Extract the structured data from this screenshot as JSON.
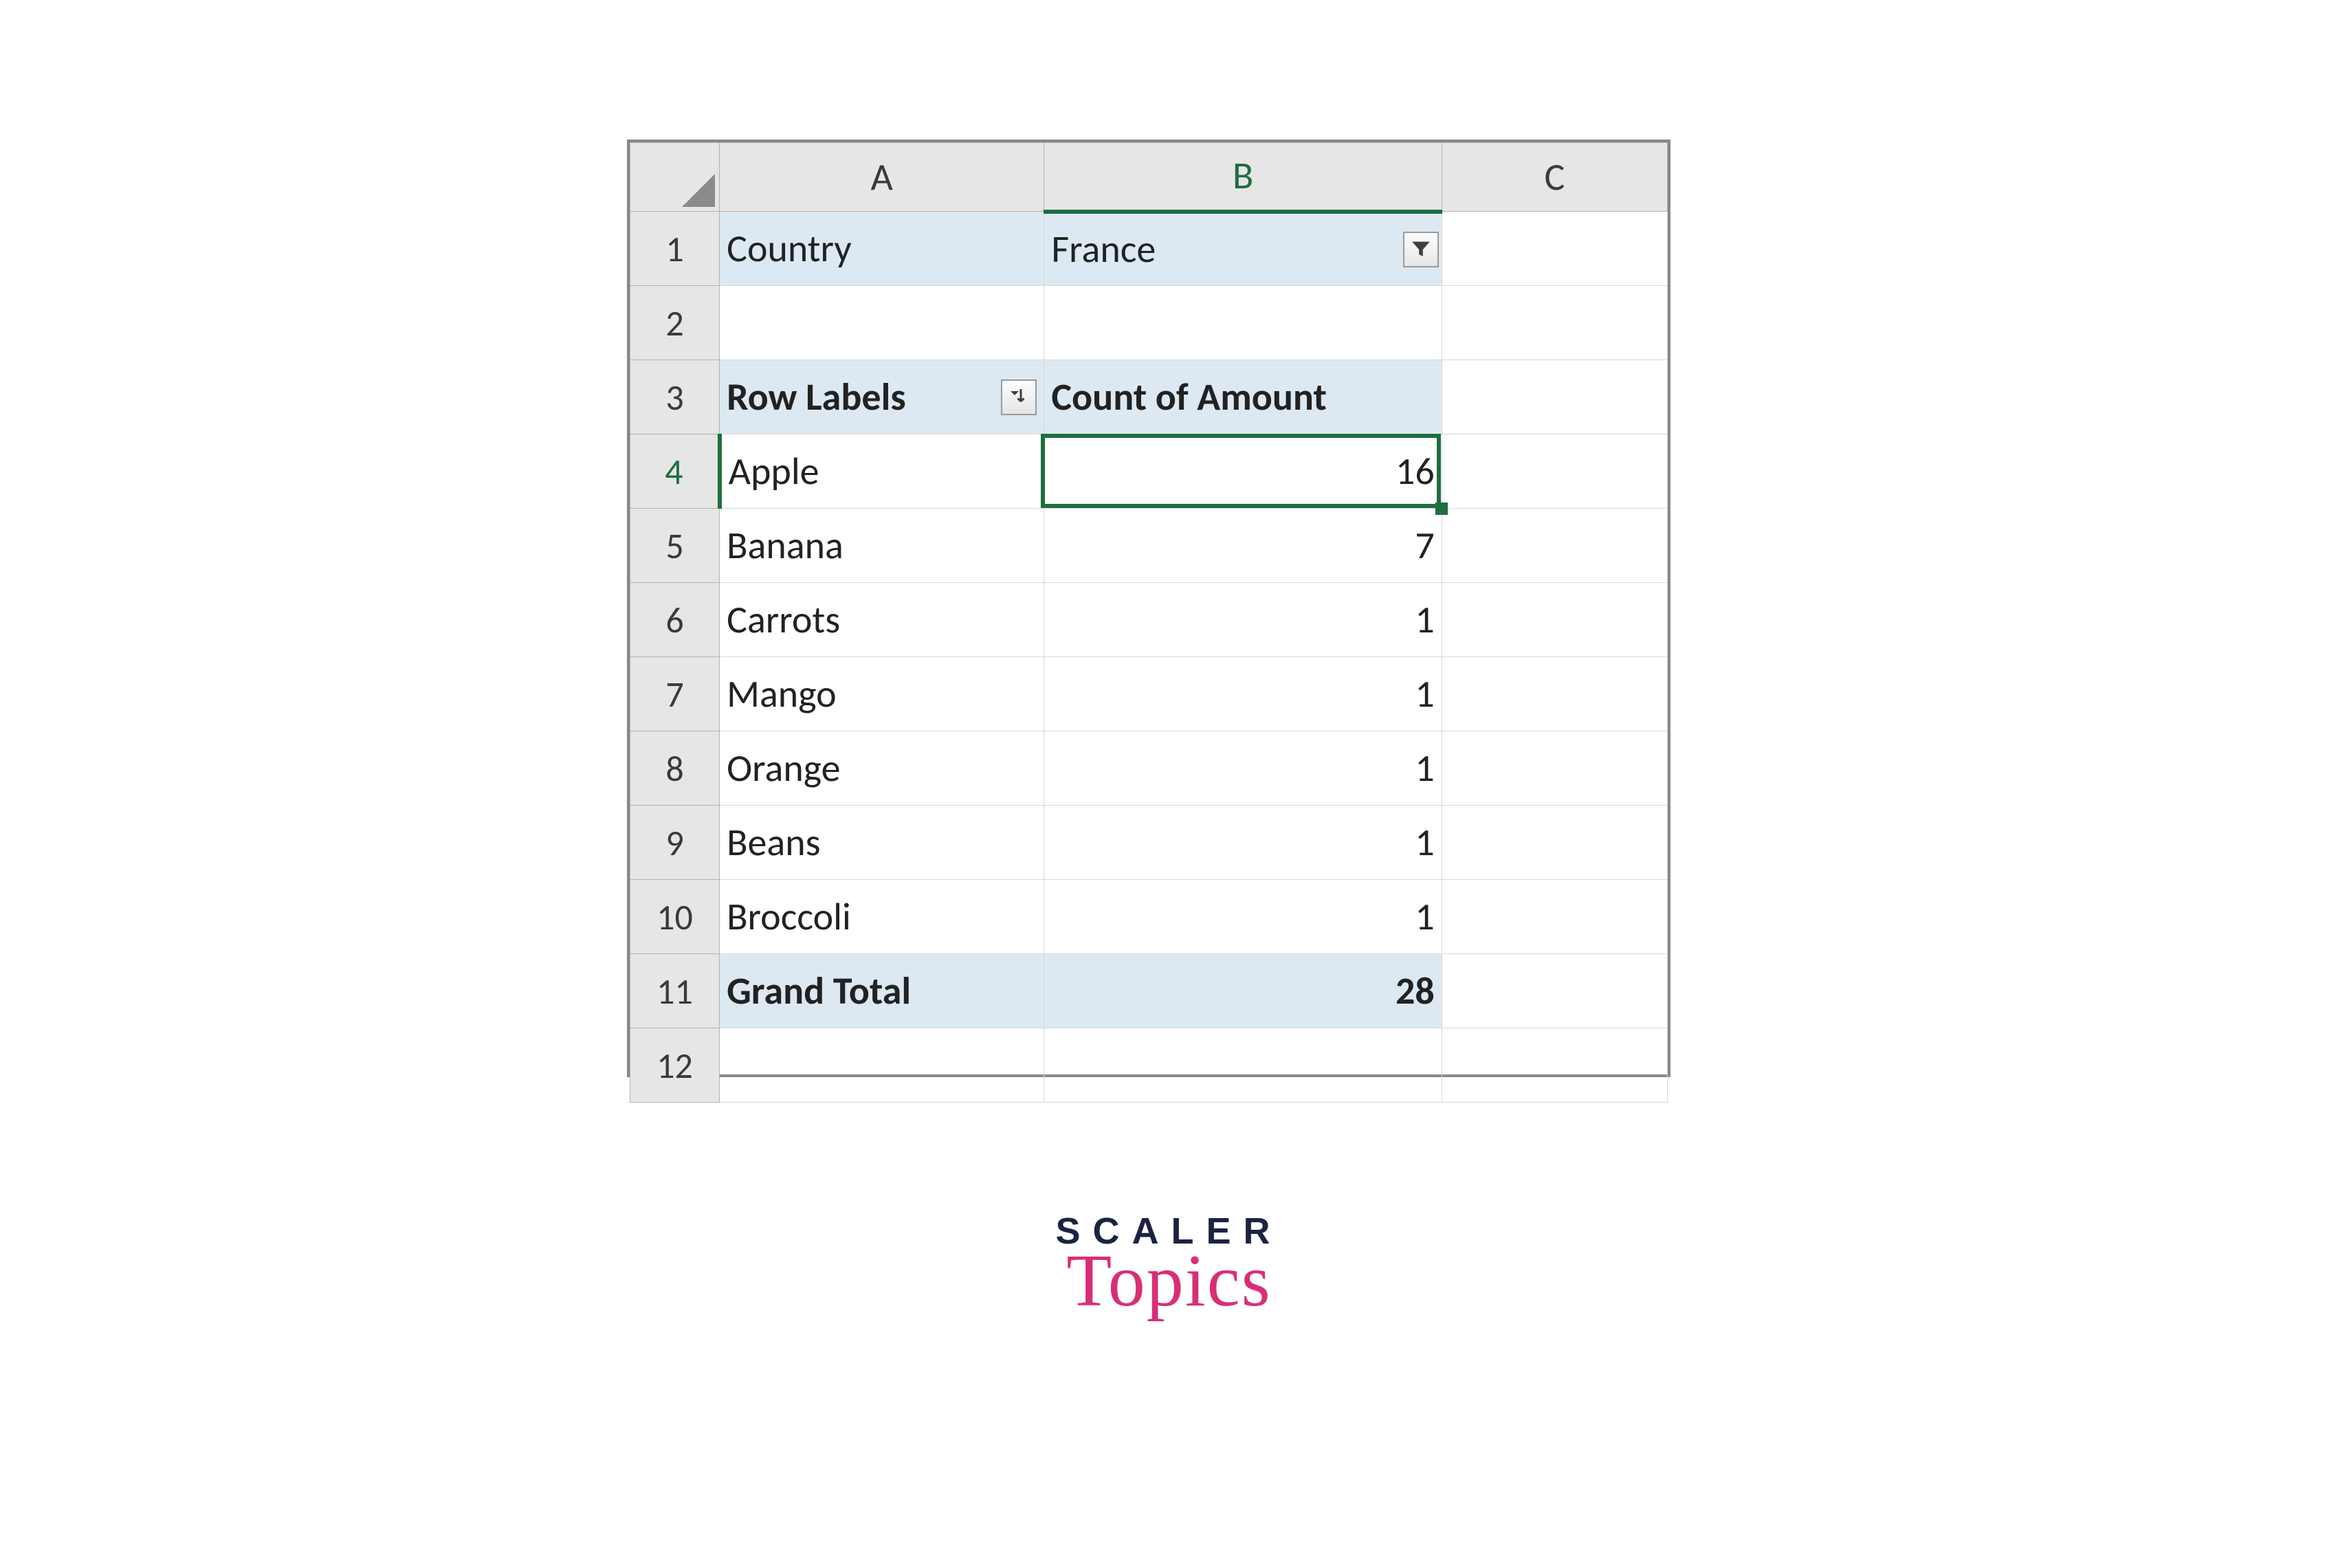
{
  "columns": {
    "A": "A",
    "B": "B",
    "C": "C"
  },
  "rowNumbers": [
    "1",
    "2",
    "3",
    "4",
    "5",
    "6",
    "7",
    "8",
    "9",
    "10",
    "11",
    "12"
  ],
  "pivot": {
    "filterLabel": "Country",
    "filterValue": "France",
    "rowLabelsHeader": "Row Labels",
    "valuesHeader": "Count of Amount",
    "rows": [
      {
        "label": "Apple",
        "value": 16
      },
      {
        "label": "Banana",
        "value": 7
      },
      {
        "label": "Carrots",
        "value": 1
      },
      {
        "label": "Mango",
        "value": 1
      },
      {
        "label": "Orange",
        "value": 1
      },
      {
        "label": "Beans",
        "value": 1
      },
      {
        "label": "Broccoli",
        "value": 1
      }
    ],
    "grandTotalLabel": "Grand Total",
    "grandTotalValue": 28
  },
  "activeCell": "B4",
  "branding": {
    "line1": "SCALER",
    "line2": "Topics"
  }
}
